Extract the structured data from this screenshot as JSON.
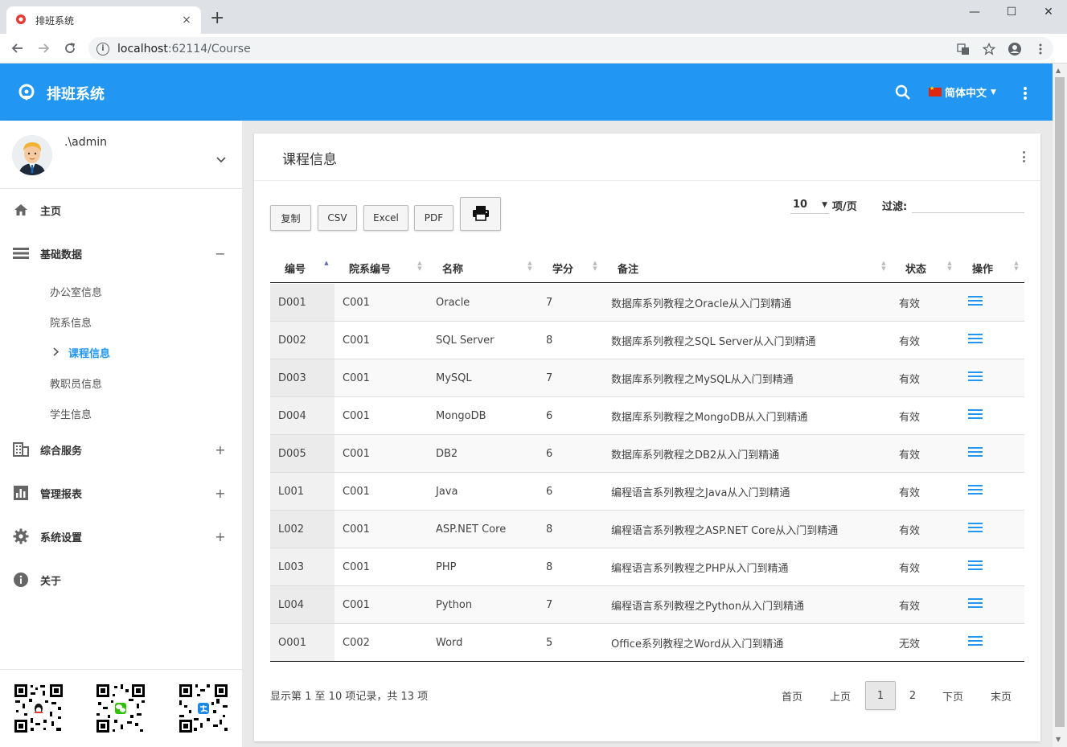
{
  "browser": {
    "tab_title": "排班系统",
    "tab_close": "×",
    "new_tab": "+",
    "url_host": "localhost",
    "url_path": ":62114/Course",
    "win_min": "—",
    "win_max": "☐",
    "win_close": "✕"
  },
  "header": {
    "title": "排班系统",
    "language": "简体中文"
  },
  "sidebar": {
    "user": ".\\admin",
    "menu": [
      {
        "label": "主页",
        "icon": "home-icon",
        "toggle": ""
      },
      {
        "label": "基础数据",
        "icon": "list-icon",
        "toggle": "−"
      },
      {
        "label": "综合服务",
        "icon": "building-icon",
        "toggle": "+"
      },
      {
        "label": "管理报表",
        "icon": "bar-chart-icon",
        "toggle": "+"
      },
      {
        "label": "系统设置",
        "icon": "gear-icon",
        "toggle": "+"
      },
      {
        "label": "关于",
        "icon": "info-icon",
        "toggle": ""
      }
    ],
    "submenu": [
      "办公室信息",
      "院系信息",
      "课程信息",
      "教职员信息",
      "学生信息"
    ]
  },
  "card": {
    "title": "课程信息",
    "buttons": {
      "copy": "复制",
      "csv": "CSV",
      "excel": "Excel",
      "pdf": "PDF"
    },
    "page_length": "10",
    "page_length_label": "项/页",
    "filter_label": "过滤:",
    "filter_value": ""
  },
  "table": {
    "columns": [
      "编号",
      "院系编号",
      "名称",
      "学分",
      "备注",
      "状态",
      "操作"
    ],
    "rows": [
      [
        "D001",
        "C001",
        "Oracle",
        "7",
        "数据库系列教程之Oracle从入门到精通",
        "有效"
      ],
      [
        "D002",
        "C001",
        "SQL Server",
        "8",
        "数据库系列教程之SQL Server从入门到精通",
        "有效"
      ],
      [
        "D003",
        "C001",
        "MySQL",
        "7",
        "数据库系列教程之MySQL从入门到精通",
        "有效"
      ],
      [
        "D004",
        "C001",
        "MongoDB",
        "6",
        "数据库系列教程之MongoDB从入门到精通",
        "有效"
      ],
      [
        "D005",
        "C001",
        "DB2",
        "6",
        "数据库系列教程之DB2从入门到精通",
        "有效"
      ],
      [
        "L001",
        "C001",
        "Java",
        "6",
        "编程语言系列教程之Java从入门到精通",
        "有效"
      ],
      [
        "L002",
        "C001",
        "ASP.NET Core",
        "8",
        "编程语言系列教程之ASP.NET Core从入门到精通",
        "有效"
      ],
      [
        "L003",
        "C001",
        "PHP",
        "8",
        "编程语言系列教程之PHP从入门到精通",
        "有效"
      ],
      [
        "L004",
        "C001",
        "Python",
        "7",
        "编程语言系列教程之Python从入门到精通",
        "有效"
      ],
      [
        "O001",
        "C002",
        "Word",
        "5",
        "Office系列教程之Word从入门到精通",
        "无效"
      ]
    ]
  },
  "footer": {
    "info": "显示第 1 至 10 项记录，共 13 项",
    "pagination": [
      "首页",
      "上页",
      "1",
      "2",
      "下页",
      "末页"
    ]
  }
}
